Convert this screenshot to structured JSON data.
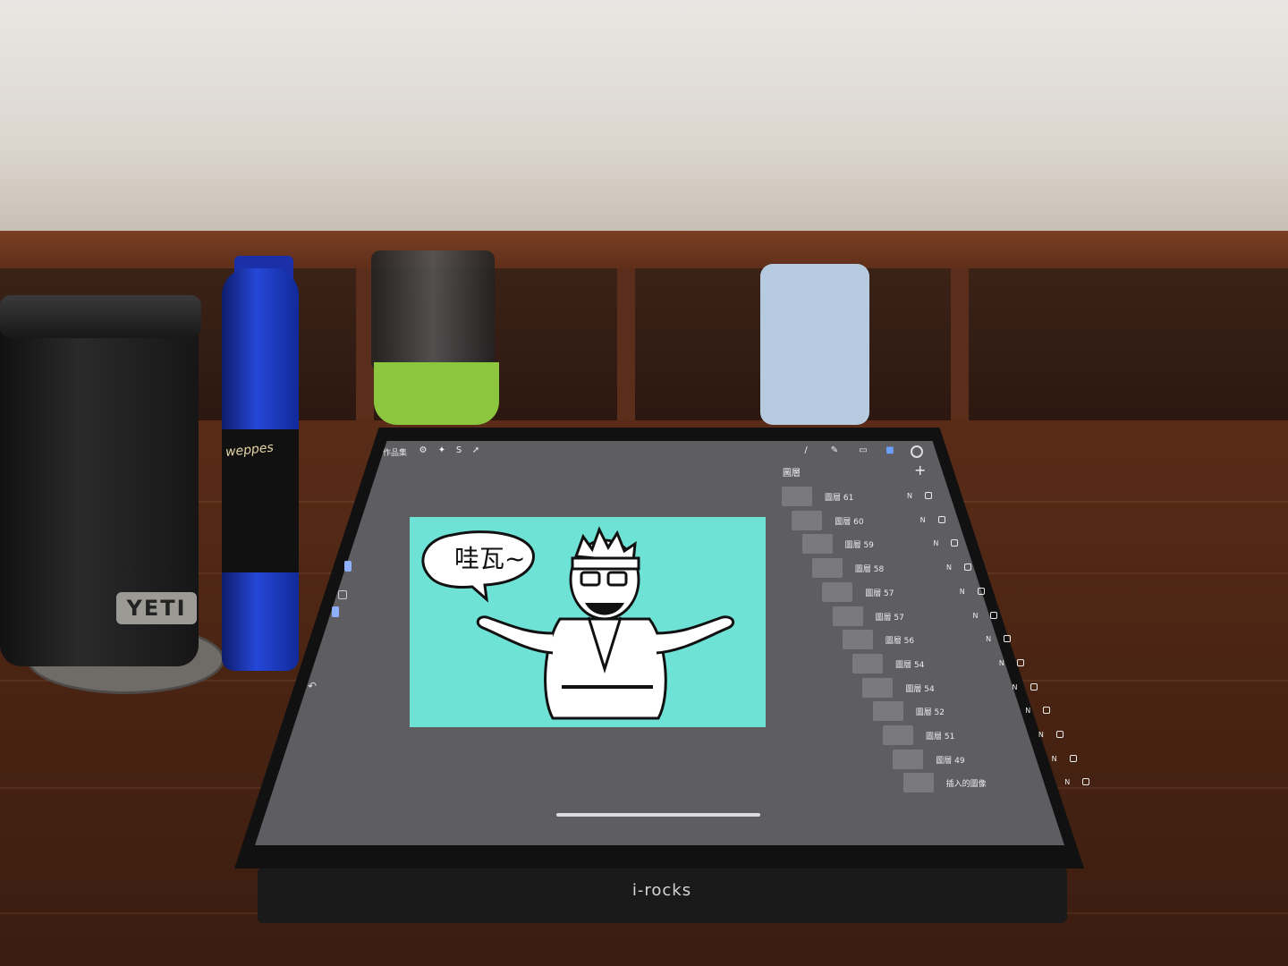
{
  "tumbler": {
    "brand": "YETI"
  },
  "bottle": {
    "brand": "weppes"
  },
  "stand": {
    "brand": "i-rocks"
  },
  "app": {
    "toolbar": {
      "gallery_label": "作品集",
      "tool_icons": [
        "wrench-icon",
        "magic-wand-icon",
        "selection-icon",
        "move-icon",
        "brush-icon",
        "smudge-icon",
        "eraser-icon",
        "layers-icon",
        "color-icon"
      ]
    },
    "layers_panel": {
      "title": "圖層",
      "add_label": "+",
      "layers": [
        {
          "name": "圖層 61",
          "mode": "N"
        },
        {
          "name": "圖層 60",
          "mode": "N"
        },
        {
          "name": "圖層 59",
          "mode": "N"
        },
        {
          "name": "圖層 58",
          "mode": "N"
        },
        {
          "name": "圖層 57",
          "mode": "N"
        },
        {
          "name": "圖層 57",
          "mode": "N"
        },
        {
          "name": "圖層 56",
          "mode": "N"
        },
        {
          "name": "圖層 54",
          "mode": "N"
        },
        {
          "name": "圖層 54",
          "mode": "N"
        },
        {
          "name": "圖層 52",
          "mode": "N"
        },
        {
          "name": "圖層 51",
          "mode": "N"
        },
        {
          "name": "圖層 49",
          "mode": "N"
        },
        {
          "name": "插入的圖像",
          "mode": "N"
        }
      ]
    },
    "artwork": {
      "speech_text": "哇瓦~",
      "background_color": "#6fe2d6"
    }
  }
}
